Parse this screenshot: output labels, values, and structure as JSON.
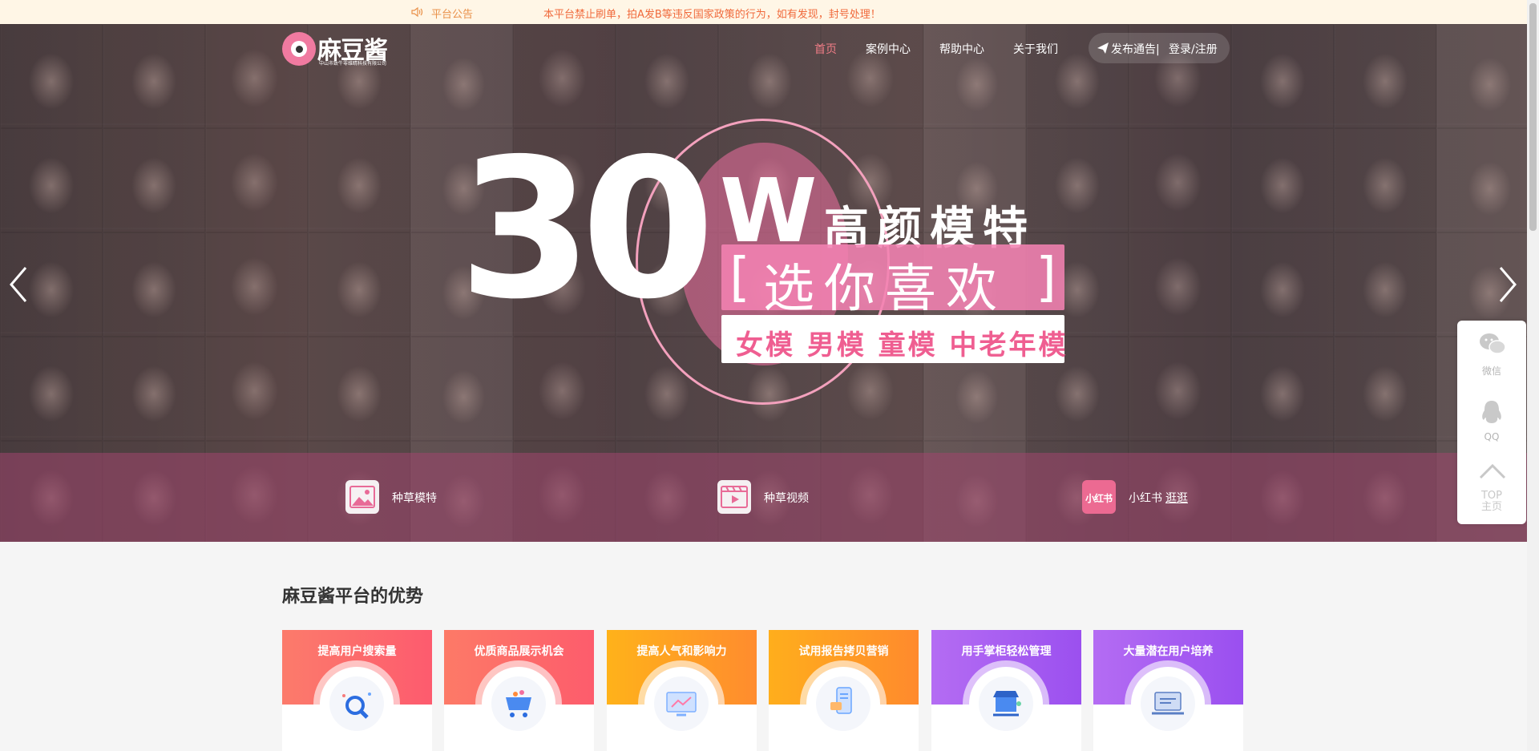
{
  "notice": {
    "title": "平台公告",
    "text": "本平台禁止刷单，拍A发B等违反国家政策的行为，如有发现，封号处理！"
  },
  "logo": {
    "name": "麻豆酱",
    "subtitle": "中山市致牛零维睛科技有限公司"
  },
  "nav": {
    "items": [
      "首页",
      "案例中心",
      "帮助中心",
      "关于我们"
    ],
    "active": "首页",
    "publish_label": "发布通告|",
    "login_label": "登录/注册"
  },
  "hero": {
    "number": "30",
    "unit": "W",
    "headline": "高颜模特",
    "bracket_left": "[",
    "bracket_right": "]",
    "slogan": "选你喜欢",
    "categories": "女模 男模 童模 中老年模"
  },
  "features": [
    {
      "label": "种草模特",
      "icon": "image-icon"
    },
    {
      "label": "种草视频",
      "icon": "video-icon"
    },
    {
      "label": "小红书",
      "label_b": "逛逛",
      "icon": "xiaohongshu-icon",
      "icon_text": "小红书"
    }
  ],
  "sidebar": {
    "wechat_label": "微信",
    "qq_label": "QQ",
    "top_label": "TOP",
    "home_label": "主页"
  },
  "advantages": {
    "title": "麻豆酱平台的优势",
    "cards": [
      {
        "title": "提高用户搜索量",
        "color_from": "#fc7b6b",
        "color_to": "#fd5b6e"
      },
      {
        "title": "优质商品展示机会",
        "color_from": "#fd7a67",
        "color_to": "#fd5c6c"
      },
      {
        "title": "提高人气和影响力",
        "color_from": "#ffb21a",
        "color_to": "#ff8c2e"
      },
      {
        "title": "试用报告拷贝营销",
        "color_from": "#ffae1c",
        "color_to": "#ff8a2d"
      },
      {
        "title": "用手掌柜轻松管理",
        "color_from": "#b46cf3",
        "color_to": "#9b50ef"
      },
      {
        "title": "大量潜在用户培养",
        "color_from": "#b46cf3",
        "color_to": "#9a4ff0"
      }
    ]
  }
}
